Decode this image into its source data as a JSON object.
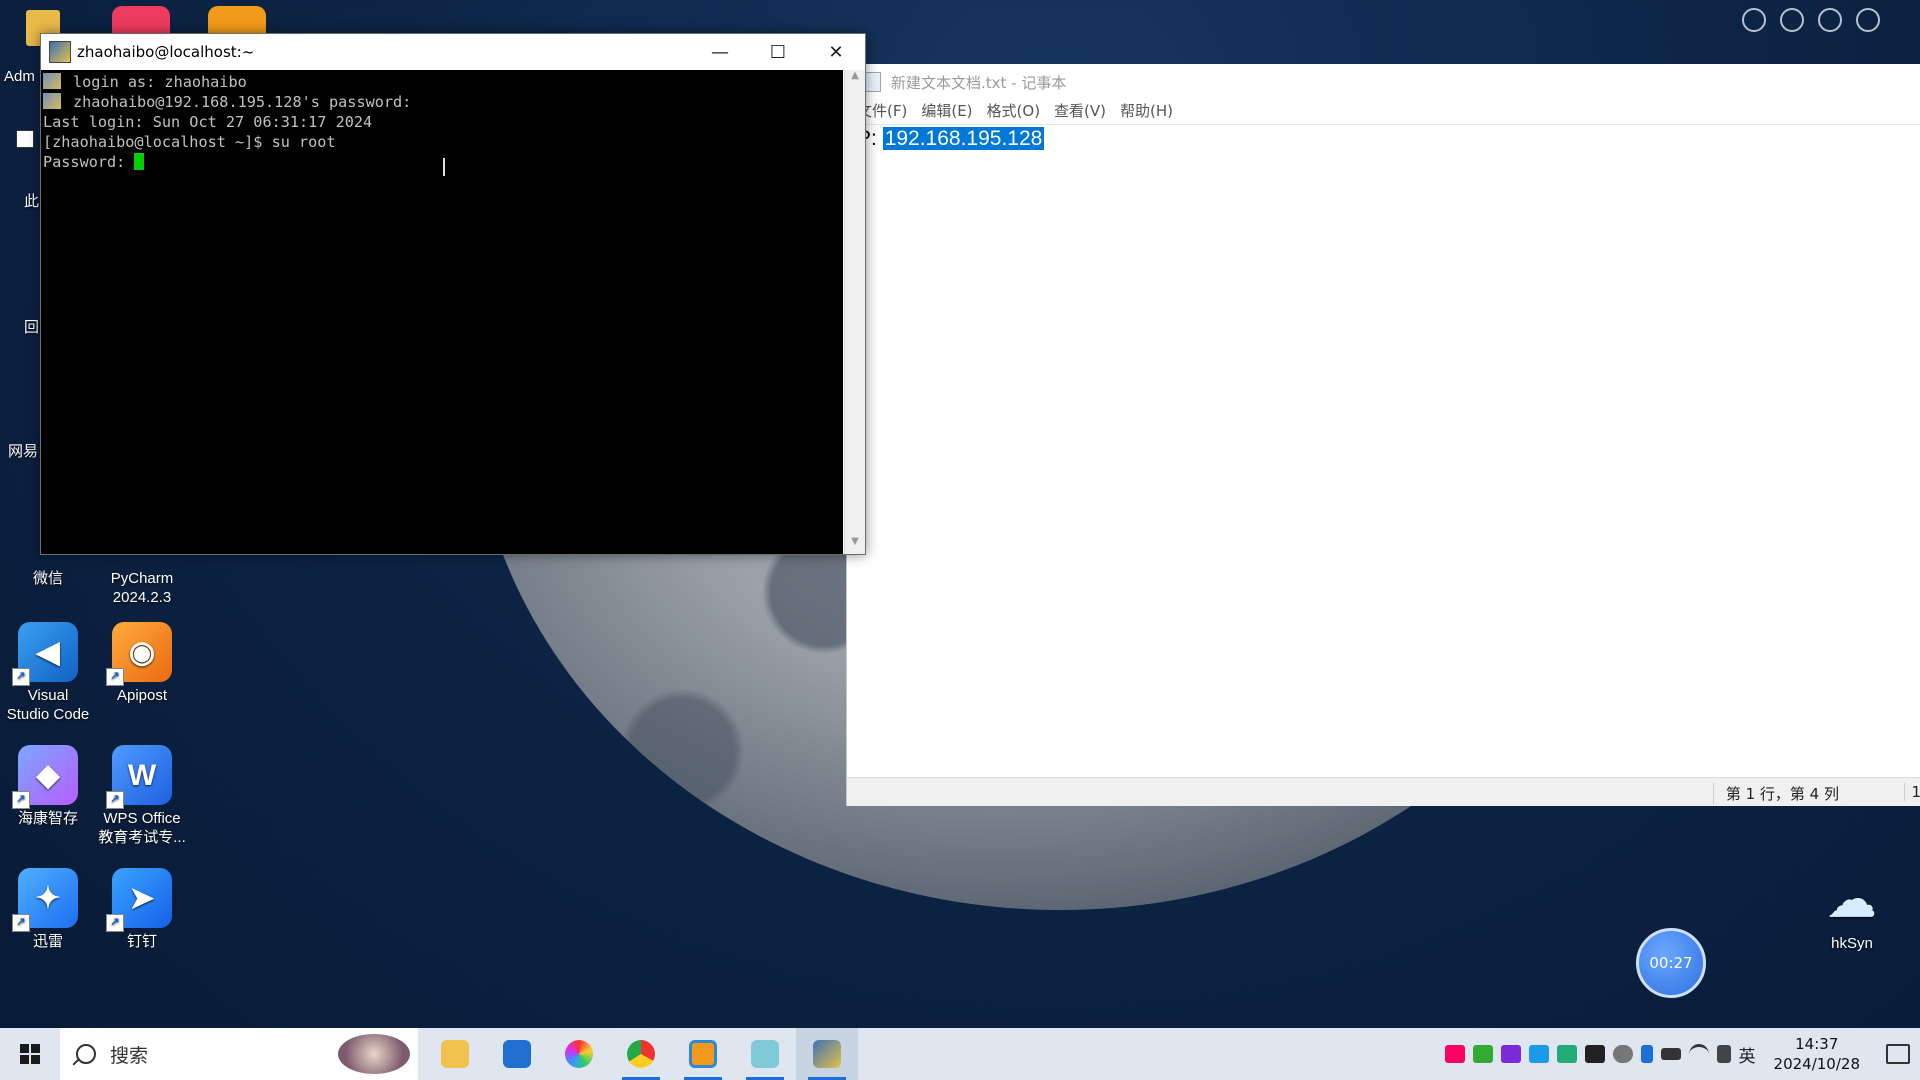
{
  "desktop": {
    "icons": [
      {
        "label_line1": "微信",
        "label_line2": ""
      },
      {
        "label_line1": "PyCharm",
        "label_line2": "2024.2.3"
      },
      {
        "label_line1": "Visual",
        "label_line2": "Studio Code"
      },
      {
        "label_line1": "Apipost",
        "label_line2": ""
      },
      {
        "label_line1": "海康智存",
        "label_line2": ""
      },
      {
        "label_line1": "WPS Office",
        "label_line2": "教育考试专..."
      },
      {
        "label_line1": "迅雷",
        "label_line2": ""
      },
      {
        "label_line1": "钉钉",
        "label_line2": ""
      },
      {
        "label_line1": "hkSyn",
        "label_line2": ""
      }
    ],
    "partial_labels": [
      "Adm",
      "此",
      "回",
      "网易"
    ]
  },
  "terminal": {
    "title": "zhaohaibo@localhost:~",
    "lines": [
      "login as: zhaohaibo",
      "zhaohaibo@192.168.195.128's password:",
      "Last login: Sun Oct 27 06:31:17 2024",
      "[zhaohaibo@localhost ~]$ su root",
      "Password: "
    ]
  },
  "notepad": {
    "title": "新建文本文档.txt - 记事本",
    "menu": [
      "文件(F)",
      "编辑(E)",
      "格式(O)",
      "查看(V)",
      "帮助(H)"
    ],
    "content_prefix": "P:",
    "selected_text": "192.168.195.128",
    "status_position": "第 1 行，第 4 列",
    "status_edge": "1"
  },
  "timer": {
    "value": "00:27"
  },
  "taskbar": {
    "search_placeholder": "搜索",
    "tray_lang": "英",
    "time": "14:37",
    "date": "2024/10/28"
  }
}
